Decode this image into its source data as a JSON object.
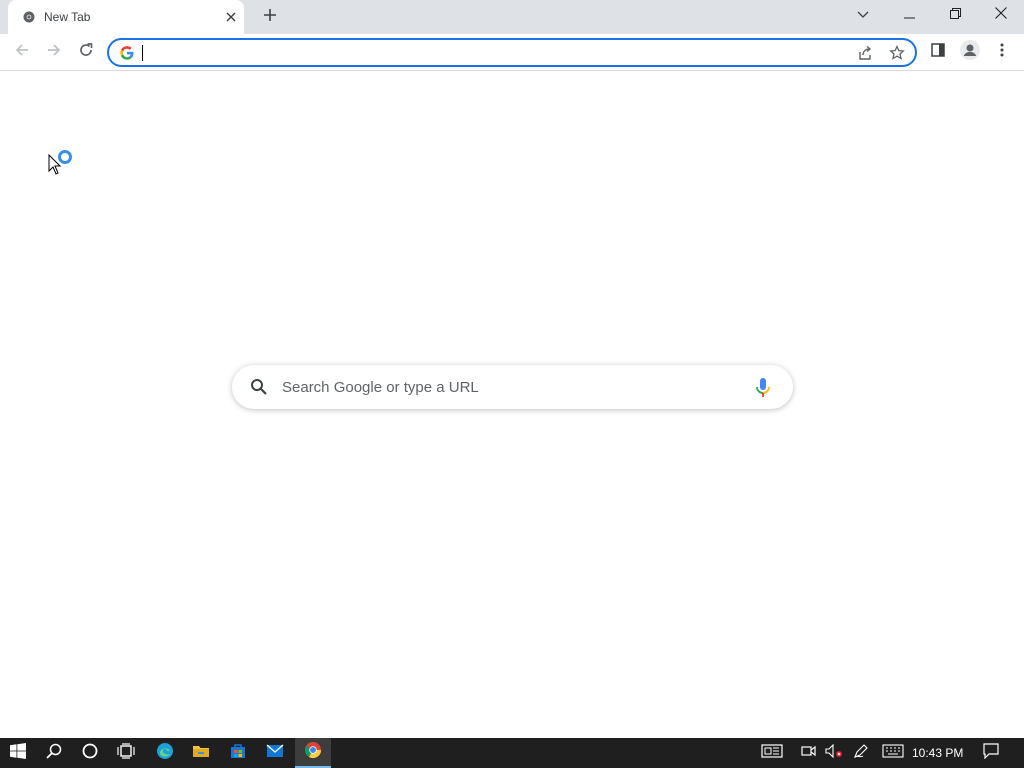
{
  "browser": {
    "tab": {
      "title": "New Tab"
    },
    "toolbar": {
      "omnibox_value": ""
    }
  },
  "ntp": {
    "search_placeholder": "Search Google or type a URL"
  },
  "taskbar": {
    "clock": "10:43 PM"
  },
  "colors": {
    "accent": "#1a73e8",
    "tabstrip": "#dee1e6",
    "taskbar": "#1f1f1f"
  },
  "icons": [
    "chrome-favicon",
    "close-icon",
    "plus-icon",
    "chevron-down-icon",
    "minimize-icon",
    "restore-icon",
    "close-window-icon",
    "back-icon",
    "forward-icon",
    "reload-icon",
    "google-g-icon",
    "share-icon",
    "star-icon",
    "side-panel-icon",
    "profile-icon",
    "menu-icon",
    "search-icon",
    "mic-icon",
    "windows-start-icon",
    "taskbar-search-icon",
    "cortana-icon",
    "task-view-icon",
    "edge-icon",
    "file-explorer-icon",
    "store-icon",
    "mail-icon",
    "chrome-icon",
    "news-icon",
    "meet-icon",
    "volume-muted-icon",
    "pen-icon",
    "keyboard-icon",
    "notification-icon"
  ]
}
